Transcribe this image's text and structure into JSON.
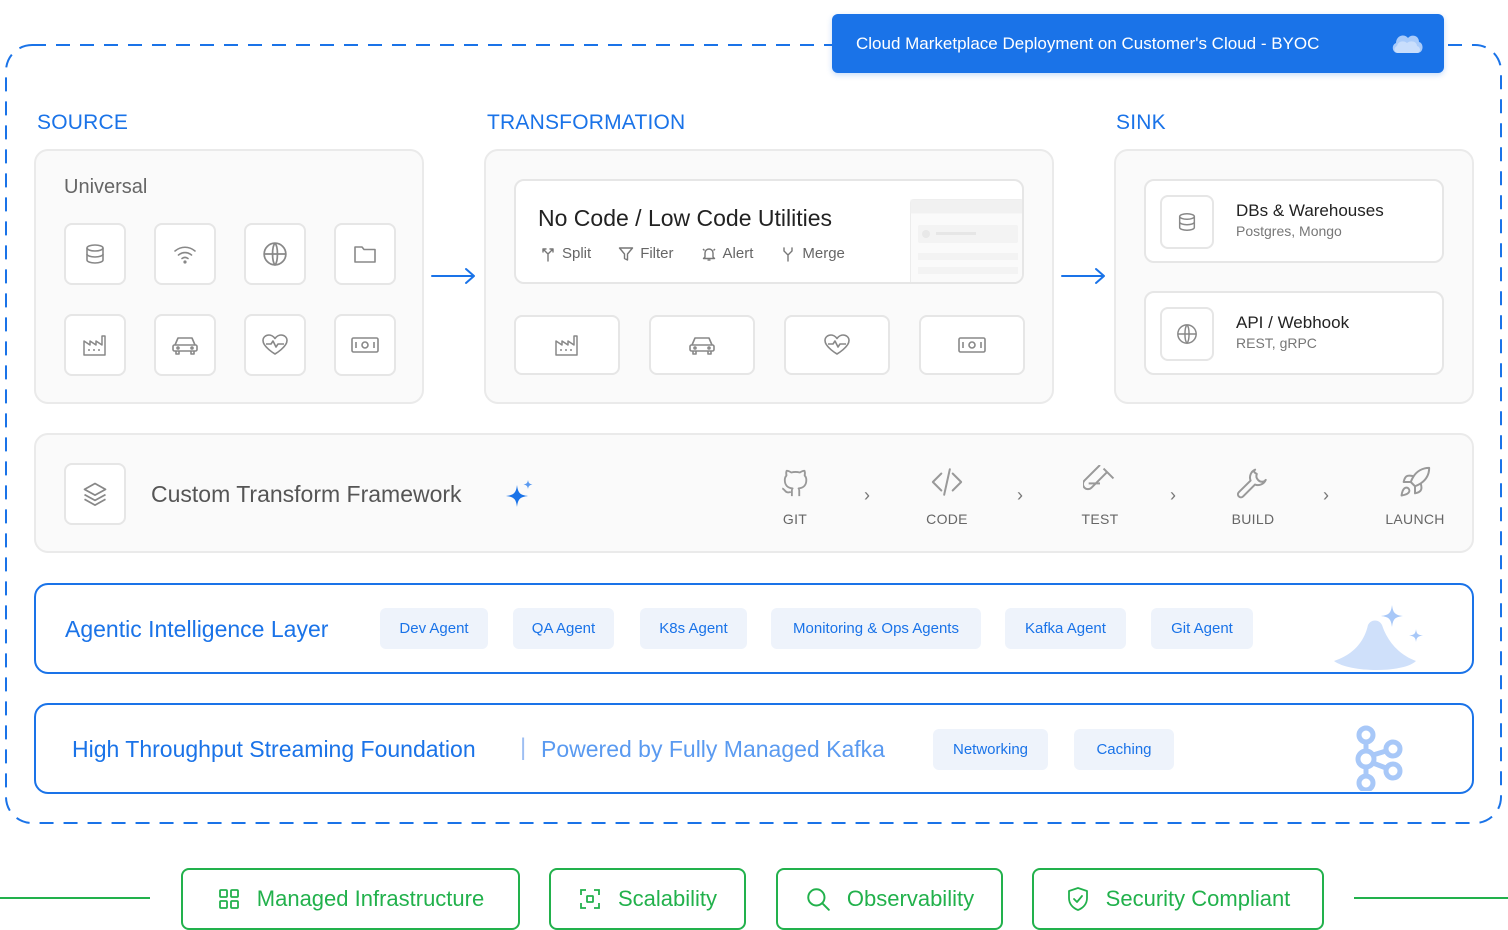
{
  "banner": {
    "text": "Cloud Marketplace Deployment on Customer's Cloud - BYOC",
    "icon": "cloud-icon"
  },
  "source": {
    "title": "SOURCE",
    "label": "Universal",
    "icons": [
      "database-icon",
      "wifi-icon",
      "globe-icon",
      "folder-icon",
      "factory-icon",
      "car-icon",
      "heart-pulse-icon",
      "banknote-icon"
    ]
  },
  "transformation": {
    "title": "TRANSFORMATION",
    "nocode_title": "No Code / Low Code Utilities",
    "utilities": [
      "Split",
      "Filter",
      "Alert",
      "Merge"
    ],
    "icons": [
      "factory-icon",
      "car-icon",
      "heart-pulse-icon",
      "banknote-icon"
    ]
  },
  "sink": {
    "title": "SINK",
    "cards": [
      {
        "title": "DBs & Warehouses",
        "subtitle": "Postgres, Mongo",
        "icon": "database-icon"
      },
      {
        "title": "API / Webhook",
        "subtitle": "REST, gRPC",
        "icon": "globe-icon"
      }
    ]
  },
  "custom_transform": {
    "title": "Custom Transform Framework",
    "steps": [
      "GIT",
      "CODE",
      "TEST",
      "BUILD",
      "LAUNCH"
    ]
  },
  "agentic": {
    "title": "Agentic Intelligence Layer",
    "chips": [
      "Dev Agent",
      "QA Agent",
      "K8s Agent",
      "Monitoring & Ops Agents",
      "Kafka Agent",
      "Git Agent"
    ]
  },
  "streaming": {
    "title": "High Throughput Streaming Foundation",
    "subtitle": "Powered by Fully Managed Kafka",
    "divider": "|",
    "chips": [
      "Networking",
      "Caching"
    ]
  },
  "features": [
    "Managed Infrastructure",
    "Scalability",
    "Observability",
    "Security Compliant"
  ],
  "colors": {
    "accent": "#1a73e8",
    "green": "#22b14c"
  }
}
